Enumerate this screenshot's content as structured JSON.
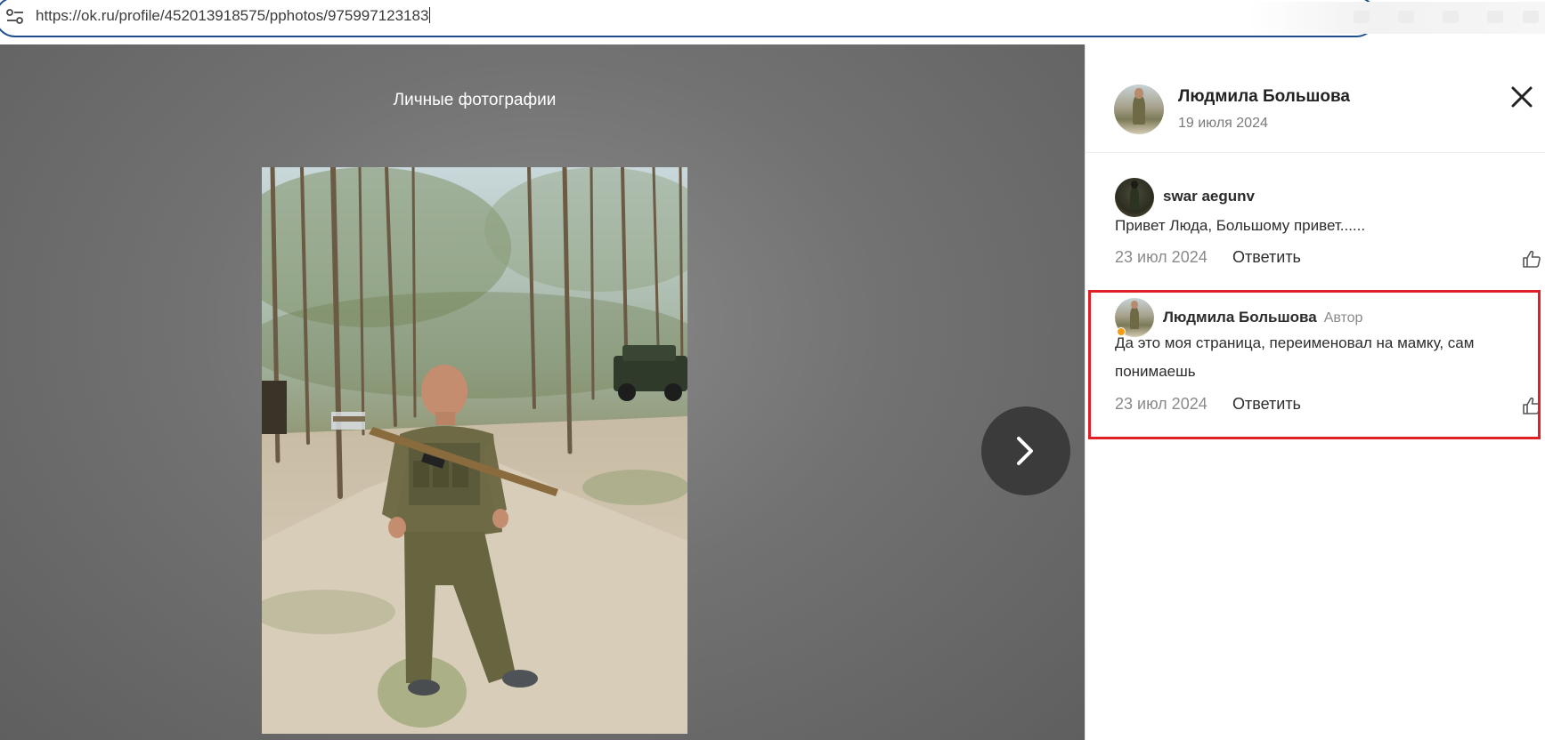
{
  "browser": {
    "url": "https://ok.ru/profile/452013918575/pphotos/975997123183"
  },
  "viewer": {
    "album_title": "Личные фотографии"
  },
  "post": {
    "author_name": "Людмила Большова",
    "date": "19 июля 2024"
  },
  "comments": [
    {
      "author": "swar aegunv",
      "text": "Привет Люда, Большому привет......",
      "date": "23 июл 2024",
      "reply_label": "Ответить"
    },
    {
      "author": "Людмила Большова",
      "badge": "Автор",
      "text": "Да это моя страница, переименовал на мамку, сам понимаешь",
      "date": "23 июл 2024",
      "reply_label": "Ответить"
    }
  ],
  "colors": {
    "highlight": "#e01e25",
    "url_border": "#1f4e8c",
    "online_dot": "#f59d10"
  }
}
